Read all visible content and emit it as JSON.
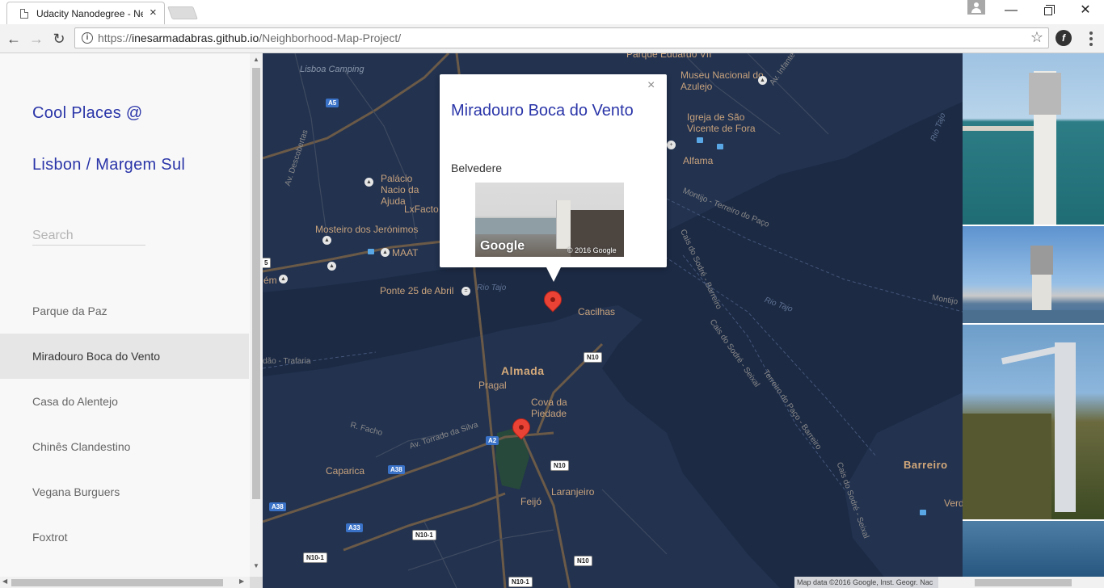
{
  "browser": {
    "tab_title": "Udacity Nanodegree - Ne",
    "tab_close": "×",
    "url_prefix": "https://",
    "url_host": "inesarmadabras.github.io",
    "url_path": "/Neighborhood-Map-Project/",
    "window_min": "—",
    "window_close": "✕",
    "back": "←",
    "forward": "→",
    "reload": "↻",
    "info": "i",
    "star": "☆",
    "extension": "f"
  },
  "sidebar": {
    "title_line1": "Cool Places @",
    "title_line2": "Lisbon / Margem Sul",
    "search_placeholder": "Search",
    "places": [
      {
        "label": "Parque da Paz"
      },
      {
        "label": "Miradouro Boca do Vento"
      },
      {
        "label": "Casa do Alentejo"
      },
      {
        "label": "Chinês Clandestino"
      },
      {
        "label": "Vegana Burguers"
      },
      {
        "label": "Foxtrot"
      }
    ],
    "selected_index": 1
  },
  "infowindow": {
    "title": "Miradouro Boca do Vento",
    "category": "Belvedere",
    "close": "×",
    "photo_brand": "Google",
    "photo_copyright": "© 2016 Google"
  },
  "map": {
    "labels": {
      "lisboa_camping": "Lisboa Camping",
      "museu_azulejo": "Museu Nacional do Azulejo",
      "igreja": "Igreja de São Vicente de Fora",
      "alfama": "Alfama",
      "palacio": "Palácio Nacio da Ajuda",
      "lxfactory": "LxFacto",
      "mosteiro": "Mosteiro dos Jerónimos",
      "maat": "MAAT",
      "ponte": "Ponte 25 de Abril",
      "cacilhas": "Cacilhas",
      "almada": "Almada",
      "pragal": "Pragal",
      "cova": "Cova da Piedade",
      "caparica": "Caparica",
      "laranjeiro": "Laranjeiro",
      "feijo": "Feijó",
      "barreiro": "Barreiro",
      "verd": "Verd",
      "belem": "ém",
      "rio_tajo_1": "Rio Tajo",
      "rio_tajo_2": "Rio Tajo",
      "rio_tajo_3": "Rio Tajo",
      "montijo": "Montijo",
      "montijo_terreiro": "Montijo - Terreiro do Paço",
      "cais_sodre_barreiro": "Cais do Sodré - Barreiro",
      "cais_sodre_seixal": "Cais do Sodré - Seixal",
      "terreiro_barreiro": "Terreiro do Paço - Barreiro",
      "barreiro_small": "Barreiro",
      "trafaria": "dão - Trafaria",
      "r_facho": "R. Facho",
      "av_torrado": "Av. Torrado da Silva",
      "av_descobertas": "Av. Descobertas",
      "av_infante": "Av. Infante",
      "parque_eduardo": "Parque Eduardo VII",
      "cais_seixal": "Cais do Sodré - Seixal"
    },
    "shields": {
      "a5": "A5",
      "a2": "A2",
      "a38_1": "A38",
      "a38_2": "A38",
      "a33": "A33",
      "n10_1": "N10",
      "n10_2": "N10",
      "n10_3": "N10",
      "n10_1a": "N10-1",
      "n10_1b": "N10-1",
      "n10_1c": "N10-1",
      "num5": "5"
    },
    "attribution": "Map data ©2016 Google, Inst. Geogr. Nac",
    "colors": {
      "water": "#1c2a44",
      "land": "#22324f",
      "road": "#6b5a47",
      "marker": "#ea4335",
      "label": "#c9a37d"
    }
  },
  "colors": {
    "accent": "#2a35a8",
    "sidebar_bg": "#f8f8f8",
    "selected_bg": "#e6e6e6"
  }
}
